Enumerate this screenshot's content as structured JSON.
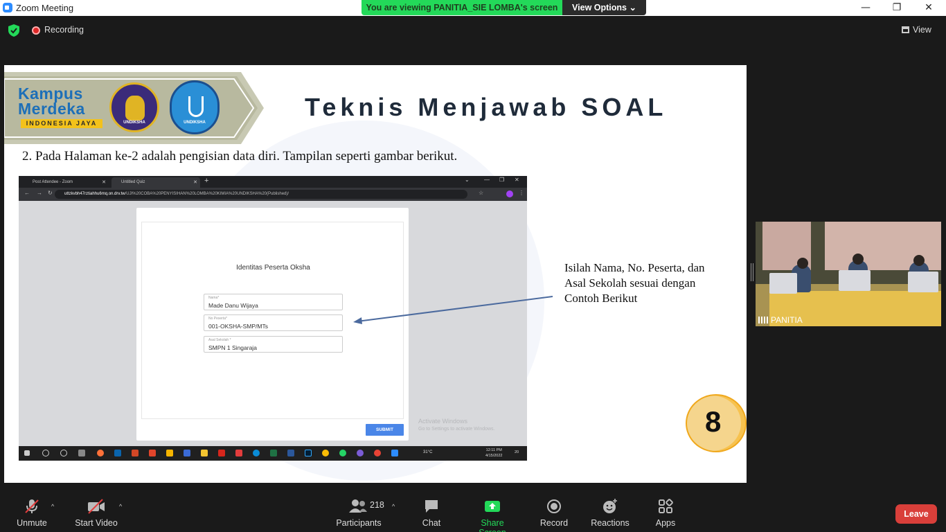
{
  "window": {
    "title": "Zoom Meeting",
    "minimize": "—",
    "maximize": "❐",
    "close": "✕"
  },
  "share_banner": {
    "message": "You are viewing PANITIA_SIE LOMBA's screen",
    "view_options": "View Options ⌄"
  },
  "topbar": {
    "recording_label": "Recording",
    "view_label": "View"
  },
  "slide": {
    "logo_text": "Kampus Merdeka",
    "logo_tagline": "INDONESIA JAYA",
    "seal1_text": "UNDIKSHA",
    "seal2_text": "UNDIKSHA",
    "title": "Teknis Menjawab SOAL",
    "step_text": "2. Pada Halaman ke-2 adalah pengisian data diri. Tampilan seperti gambar berikut.",
    "callout_lines": [
      "Isilah Nama, No. Peserta, dan",
      "Asal Sekolah sesuai dengan",
      "Contoh Berikut"
    ],
    "page_number": "8"
  },
  "browser": {
    "tab1": "Post Attendee - Zoom",
    "tab2": "Untitled Quiz",
    "url_host": "uttzkvbh47rztiahhu6mq.on.drv.tw",
    "url_path": "/UJI%20COBA%20PENYISIHAN%20LOMBA%20KIMIA%20UNDIKSHA%20(Published)/",
    "quiz_title": "Identitas Peserta Oksha",
    "fields": [
      {
        "label": "Nama*",
        "value": "Made Danu Wijaya"
      },
      {
        "label": "No Peserta*",
        "value": "001-OKSHA-SMP/MTs"
      },
      {
        "label": "Asal Sekolah *",
        "value": "SMPN 1 Singaraja"
      }
    ],
    "submit_label": "SUBMIT",
    "activate_title": "Activate Windows",
    "activate_sub": "Go to Settings to activate Windows.",
    "taskbar_temp": "31°C",
    "taskbar_time": "12:11 PM",
    "taskbar_date": "4/15/2022",
    "taskbar_badge": "20"
  },
  "video": {
    "participant_name": "PANITIA"
  },
  "toolbar": {
    "unmute": "Unmute",
    "start_video": "Start Video",
    "participants": "Participants",
    "participants_count": "218",
    "chat": "Chat",
    "share_screen": "Share Screen",
    "record": "Record",
    "reactions": "Reactions",
    "apps": "Apps",
    "leave": "Leave"
  },
  "colors": {
    "share_green": "#23d959",
    "leave_red": "#d93f3a",
    "accent_blue": "#4a86e8"
  }
}
